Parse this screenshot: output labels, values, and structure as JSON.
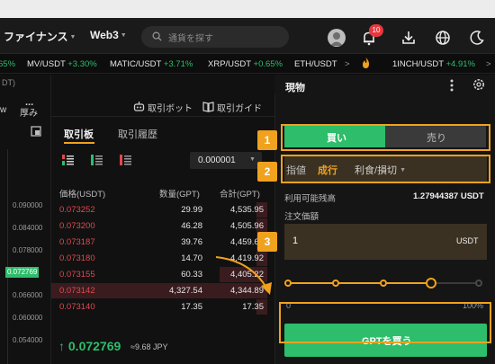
{
  "nav": {
    "finance_label": "ファイナンス",
    "web3_label": "Web3",
    "search_placeholder": "通貨を探す",
    "notification_count": "10"
  },
  "ticker": [
    {
      "pair": "",
      "change": "65%",
      "dir": "up"
    },
    {
      "pair": "MV/USDT",
      "change": "+3.30%",
      "dir": "up"
    },
    {
      "pair": "MATIC/USDT",
      "change": "+3.71%",
      "dir": "up"
    },
    {
      "pair": "XRP/USDT",
      "change": "+0.65%",
      "dir": "up"
    },
    {
      "pair": "ETH/USDT",
      "change": "",
      "dir": "up"
    },
    {
      "pair": "1INCH/USDT",
      "change": "+4.91%",
      "dir": "up"
    }
  ],
  "left": {
    "top_text": "DT)",
    "tab_w": "w",
    "tab_depth": "厚み",
    "prices": [
      "0.090000",
      "0.084000",
      "0.078000",
      "0.072769",
      "0.066000",
      "0.060000",
      "0.054000"
    ],
    "current_price_tag": "0.072769"
  },
  "center": {
    "more": "...",
    "bot_label": "取引ボット",
    "guide_label": "取引ガイド",
    "tab_orderbook": "取引板",
    "tab_history": "取引履歴",
    "precision": "0.000001",
    "col_price": "価格(USDT)",
    "col_qty": "数量(GPT)",
    "col_total": "合計(GPT)",
    "asks": [
      {
        "price": "0.073252",
        "qty": "29.99",
        "total": "4,535.95",
        "depth": 0.05
      },
      {
        "price": "0.073200",
        "qty": "46.28",
        "total": "4,505.96",
        "depth": 0.05
      },
      {
        "price": "0.073187",
        "qty": "39.76",
        "total": "4,459.68",
        "depth": 0.05
      },
      {
        "price": "0.073180",
        "qty": "14.70",
        "total": "4,419.92",
        "depth": 0.05
      },
      {
        "price": "0.073155",
        "qty": "60.33",
        "total": "4,405.22",
        "depth": 0.22
      },
      {
        "price": "0.073142",
        "qty": "4,327.54",
        "total": "4,344.89",
        "depth": 1.0
      },
      {
        "price": "0.073140",
        "qty": "17.35",
        "total": "17.35",
        "depth": 0.05
      }
    ],
    "last_price": "0.072769",
    "last_price_jpy": "≈9.68 JPY"
  },
  "panel": {
    "title": "現物",
    "buy_tab": "買い",
    "sell_tab": "売り",
    "order_limit": "指値",
    "order_market": "成行",
    "order_tpsl": "利食/損切",
    "available_label": "利用可能残高",
    "available_value": "1.27944387 USDT",
    "amount_label": "注文価額",
    "amount_value": "1",
    "amount_unit": "USDT",
    "slider_min": "0",
    "slider_max": "100%",
    "slider_fraction": 0.75,
    "buy_button": "GPTを買う"
  },
  "steps": [
    "1",
    "2",
    "3"
  ],
  "colors": {
    "buy": "#2ebd6b",
    "sell": "#e2484f",
    "accent": "#f0a21e"
  }
}
